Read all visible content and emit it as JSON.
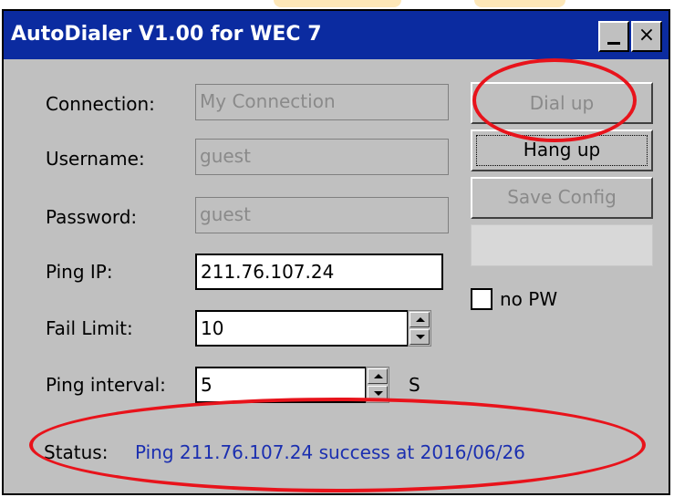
{
  "window": {
    "title": "AutoDialer V1.00 for WEC 7",
    "minimize_glyph": "_",
    "close_glyph": "×"
  },
  "form": {
    "connection": {
      "label": "Connection:",
      "value": "My Connection"
    },
    "username": {
      "label": "Username:",
      "value": "guest"
    },
    "password": {
      "label": "Password:",
      "value": "guest"
    },
    "ping_ip": {
      "label": "Ping IP:",
      "value": "211.76.107.24"
    },
    "fail_limit": {
      "label": "Fail Limit:",
      "value": "10"
    },
    "ping_interval": {
      "label": "Ping interval:",
      "value": "5",
      "unit": "S"
    }
  },
  "buttons": {
    "dial_up": "Dial up",
    "hang_up": "Hang up",
    "save_config": "Save Config"
  },
  "options": {
    "no_pw": {
      "label": "no PW",
      "checked": false
    }
  },
  "status": {
    "label": "Status:",
    "text": "Ping 211.76.107.24 success at 2016/06/26"
  },
  "colors": {
    "titlebar": "#0b2ba0",
    "window_bg": "#c0c0c0",
    "status_text": "#1b2fb0",
    "annotation": "#e8131b"
  }
}
